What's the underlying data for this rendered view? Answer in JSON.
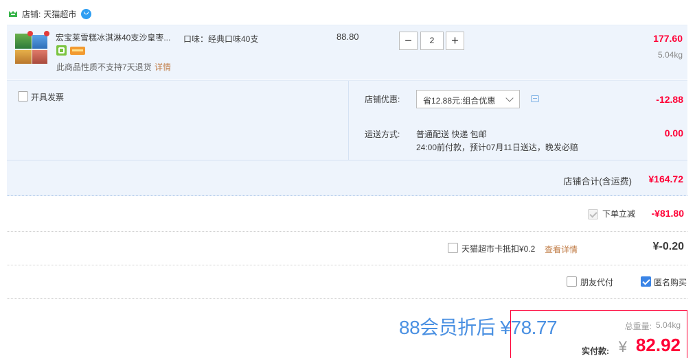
{
  "shop": {
    "label": "店铺:",
    "name": "天猫超市"
  },
  "item": {
    "title": "宏宝莱雪糕冰淇淋40支沙皇枣...",
    "sku": "口味：经典口味40支",
    "unit_price": "88.80",
    "quantity": "2",
    "minus": "−",
    "plus": "+",
    "subtotal": "177.60",
    "weight": "5.04kg",
    "notice": "此商品性质不支持7天退货",
    "detail_link": "详情"
  },
  "invoice": {
    "label": "开具发票"
  },
  "discount": {
    "label": "店铺优惠:",
    "selected": "省12.88元:组合优惠",
    "amount": "-12.88"
  },
  "delivery": {
    "label": "运送方式:",
    "method": "普通配送 快递 包邮",
    "note": "24:00前付款，预计07月11日送达，晚发必赔",
    "amount": "0.00"
  },
  "shop_total": {
    "label": "店铺合计(含运费)",
    "amount": "¥164.72"
  },
  "order_discount": {
    "label": "下单立减",
    "amount": "-¥81.80"
  },
  "card": {
    "label": "天猫超市卡抵扣¥0.2",
    "link": "查看详情",
    "amount": "¥-0.20"
  },
  "options": {
    "friend_pay": "朋友代付",
    "anonymous": "匿名购买"
  },
  "member_price": "88会员折后 ¥78.77",
  "summary": {
    "weight_label": "总重量:",
    "weight": "5.04kg",
    "pay_label": "实付款:",
    "currency": "¥",
    "pay_amount": "82.92"
  },
  "colors": {
    "accent_red": "#ff0036",
    "link_brown": "#c17d47",
    "blue_panel": "#eef4fc",
    "checkbox_blue": "#3a84e6",
    "member_blue": "#4a90e2"
  }
}
